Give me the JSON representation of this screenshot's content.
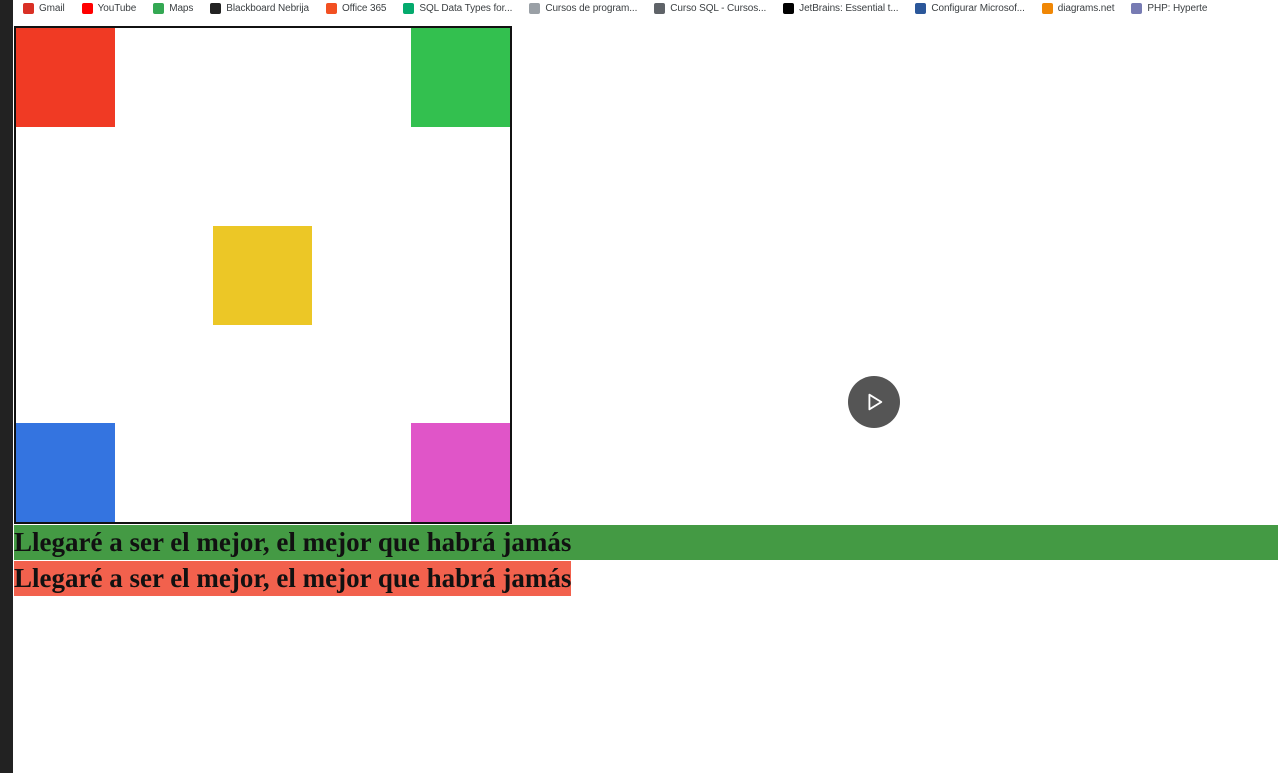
{
  "bookmarks": [
    {
      "label": "Gmail",
      "icon": "gmail-icon",
      "color": "#d93025"
    },
    {
      "label": "YouTube",
      "icon": "youtube-icon",
      "color": "#ff0000"
    },
    {
      "label": "Maps",
      "icon": "maps-icon",
      "color": "#34a853"
    },
    {
      "label": "Blackboard Nebrija",
      "icon": "blackboard-icon",
      "color": "#222222"
    },
    {
      "label": "Office 365",
      "icon": "office-icon",
      "color": "#f25022"
    },
    {
      "label": "SQL Data Types for...",
      "icon": "w3schools-icon",
      "color": "#04aa6d"
    },
    {
      "label": "Cursos de program...",
      "icon": "document-icon",
      "color": "#9aa0a6"
    },
    {
      "label": "Curso SQL - Cursos...",
      "icon": "globe-icon",
      "color": "#5f6368"
    },
    {
      "label": "JetBrains: Essential t...",
      "icon": "jetbrains-icon",
      "color": "#000000"
    },
    {
      "label": "Configurar Microsof...",
      "icon": "word-doc-icon",
      "color": "#2b579a"
    },
    {
      "label": "diagrams.net",
      "icon": "diagrams-icon",
      "color": "#f08705"
    },
    {
      "label": "PHP: Hyperte",
      "icon": "php-icon",
      "color": "#777bb3"
    }
  ],
  "board": {
    "squares": [
      {
        "name": "square-red",
        "color": "#f03a24"
      },
      {
        "name": "square-green",
        "color": "#33c04f"
      },
      {
        "name": "square-yellow",
        "color": "#ecc726"
      },
      {
        "name": "square-blue",
        "color": "#3474e0"
      },
      {
        "name": "square-pink",
        "color": "#e055c8"
      }
    ]
  },
  "lines": {
    "green": {
      "text": "Llegaré a ser el mejor, el mejor que habrá jamás",
      "background": "#449a44"
    },
    "red": {
      "text": "Llegaré a ser el mejor, el mejor que habrá jamás",
      "background": "#f2614d"
    }
  },
  "video": {
    "play_icon": "play-icon",
    "color": "#555555"
  }
}
